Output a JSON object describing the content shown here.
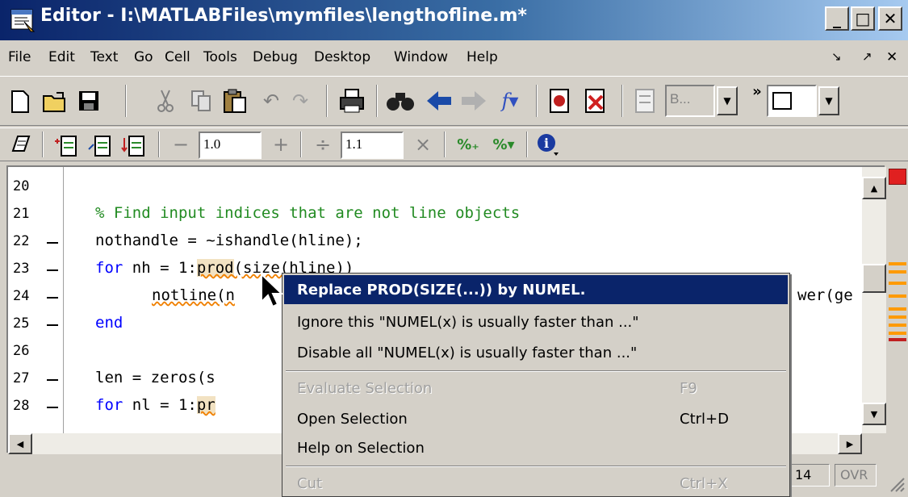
{
  "window": {
    "title": "Editor - I:\\MATLABFiles\\mymfiles\\lengthofline.m*",
    "controls": {
      "minimize": "_",
      "maximize": "□",
      "close": "✕"
    }
  },
  "menu": {
    "items": [
      "File",
      "Edit",
      "Text",
      "Go",
      "Cell",
      "Tools",
      "Debug",
      "Desktop",
      "Window",
      "Help"
    ],
    "right_controls": [
      "↘",
      "↗",
      "✕"
    ]
  },
  "toolbar1": {
    "stack_combo": "B...",
    "overflow": "»",
    "icons": [
      "new-file-icon",
      "open-folder-icon",
      "save-icon",
      "cut-icon",
      "copy-icon",
      "paste-icon",
      "undo-icon",
      "redo-icon",
      "print-icon",
      "find-icon",
      "back-icon",
      "forward-icon",
      "function-icon",
      "set-breakpoint-icon",
      "clear-breakpoint-icon",
      "step-icon",
      "stack-icon",
      "layout-icon"
    ]
  },
  "toolbar2": {
    "decrement_label": "−",
    "value1": "1.0",
    "increment_label": "+",
    "divide_label": "÷",
    "value2": "1.1",
    "multiply_label": "×",
    "icons": [
      "cell-mode-icon",
      "insert-cell-icon",
      "cell-break-icon",
      "cell-evaluate-icon",
      "percent-add-icon",
      "percent-remove-icon",
      "info-icon"
    ]
  },
  "editor": {
    "lines": [
      {
        "num": "20",
        "dash": false
      },
      {
        "num": "21",
        "dash": false
      },
      {
        "num": "22",
        "dash": true
      },
      {
        "num": "23",
        "dash": true
      },
      {
        "num": "24",
        "dash": true
      },
      {
        "num": "25",
        "dash": true
      },
      {
        "num": "26",
        "dash": false
      },
      {
        "num": "27",
        "dash": true
      },
      {
        "num": "28",
        "dash": true
      }
    ],
    "code": {
      "l21": "% Find input indices that are not line objects",
      "l22": "nothandle = ~ishandle(hline);",
      "l23_kw": "for",
      "l23_a": " nh = 1:",
      "l23_hl": "prod",
      "l23_b": "(size(hline))",
      "l24_a": "notline(n",
      "l24_b": "wer(ge",
      "l25_kw": "end",
      "l27_a": "len = zeros(s",
      "l28_kw": "for",
      "l28_a": " nl = 1:",
      "l28_hl": "pr"
    }
  },
  "context_menu": {
    "items": [
      {
        "label": "Replace PROD(SIZE(...)) by NUMEL.",
        "shortcut": "",
        "state": "highlighted"
      },
      {
        "label": "Ignore this \"NUMEL(x) is usually faster than ...\"",
        "shortcut": "",
        "state": "enabled"
      },
      {
        "label": "Disable all \"NUMEL(x) is usually faster than ...\"",
        "shortcut": "",
        "state": "enabled"
      },
      {
        "label": "Evaluate Selection",
        "shortcut": "F9",
        "state": "disabled"
      },
      {
        "label": "Open Selection",
        "shortcut": "Ctrl+D",
        "state": "enabled"
      },
      {
        "label": "Help on Selection",
        "shortcut": "",
        "state": "enabled"
      },
      {
        "label": "Cut",
        "shortcut": "Ctrl+X",
        "state": "disabled"
      }
    ]
  },
  "status": {
    "col": "14",
    "mode": "OVR"
  },
  "colors": {
    "title_active": "#0a246a",
    "keyword": "#0000ff",
    "comment": "#228b22",
    "highlight": "#f2e2c2",
    "warning_marker": "#ff9a00",
    "error_marker": "#e02020"
  }
}
